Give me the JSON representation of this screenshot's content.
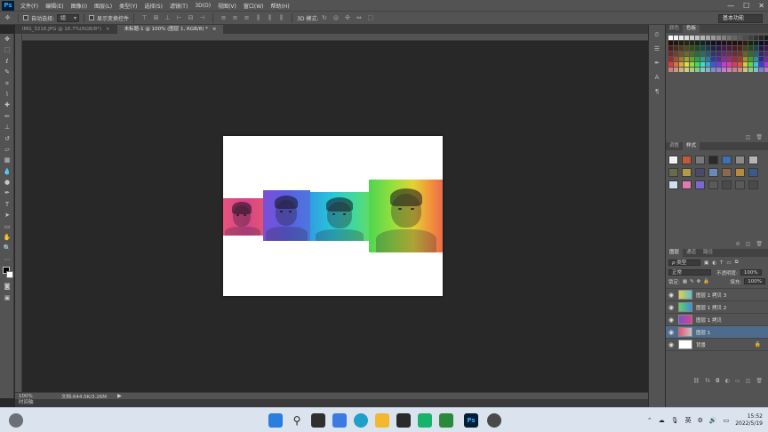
{
  "app": {
    "logo": "Ps",
    "menu": [
      "文件(F)",
      "编辑(E)",
      "图像(I)",
      "图层(L)",
      "类型(Y)",
      "选择(S)",
      "滤镜(T)",
      "3D(D)",
      "视图(V)",
      "窗口(W)",
      "帮助(H)"
    ],
    "window_controls": [
      "—",
      "☐",
      "✕"
    ]
  },
  "options_bar": {
    "auto_select_label": "自动选择:",
    "auto_select_value": "组",
    "show_transform_label": "显示变换控件",
    "mode_3d_label": "3D 模式:",
    "workspace": "基本功能"
  },
  "document_tabs": [
    {
      "label": "IMG_3216.JPG @ 16.7%(RGB/8*)",
      "close": "×",
      "active": false
    },
    {
      "label": "未标题-1 @ 100% (图层 1, RGB/8) *",
      "close": "×",
      "active": true
    }
  ],
  "status": {
    "zoom": "100%",
    "doc_info": "文档:644.5K/3.26M",
    "timeline": "时间轴"
  },
  "panels": {
    "color_tabs": [
      "颜色",
      "色板"
    ],
    "style_tabs": [
      "调整",
      "样式"
    ],
    "layer_tabs": [
      "图层",
      "通道",
      "路径"
    ],
    "filter_kind": "ρ 类型",
    "blend_mode": "正常",
    "opacity_label": "不透明度:",
    "opacity_value": "100%",
    "lock_label": "锁定:",
    "fill_label": "填充:",
    "fill_value": "100%",
    "layers": [
      {
        "name": "图层 1 拷贝 3",
        "selected": false,
        "eye": "👁",
        "thumb": "#c8c8c8"
      },
      {
        "name": "图层 1 拷贝 2",
        "selected": false,
        "eye": "👁",
        "thumb": "#c8c8c8"
      },
      {
        "name": "图层 1 拷贝",
        "selected": false,
        "eye": "👁",
        "thumb": "#c8c8c8"
      },
      {
        "name": "图层 1",
        "selected": true,
        "eye": "👁",
        "thumb": "#c8c8c8"
      },
      {
        "name": "背景",
        "selected": false,
        "eye": "👁",
        "thumb": "#ffffff",
        "locked": true
      }
    ]
  },
  "taskbar": {
    "input_method": "英",
    "time": "15:52",
    "date": "2022/5/19"
  },
  "colors": {
    "ui_dark": "#535353",
    "canvas_bg": "#282828",
    "selection": "#4f6b8c",
    "taskbar": "#dbe3ee"
  }
}
